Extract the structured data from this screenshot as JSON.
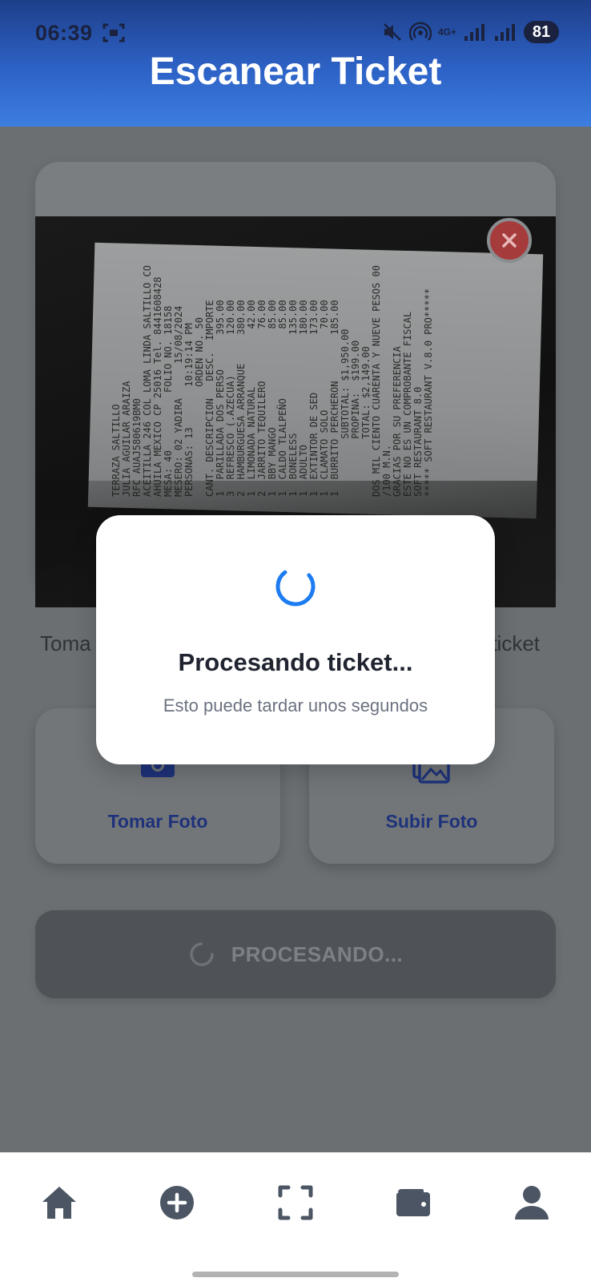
{
  "status_bar": {
    "time": "06:39",
    "network": "4G+",
    "battery": "81"
  },
  "header": {
    "title": "Escanear Ticket"
  },
  "photo": {
    "description_icon": "receipt-photo",
    "close_icon": "close-icon",
    "receipt_lines": [
      "TERRAZA SALTILLO",
      "JULIA AGUILAR ARAIZA",
      "RFC AUAJ580619BM0",
      "ACEITILLA 246 COL LOMA LINDA SALTILLO CO",
      "AHUILA MEXICO CP 25016 Tel. 8441608428",
      "MESA: 40          FOLIO NO. 18158",
      "MESERO: 02 YADIRA      15/08/2024",
      "PERSONAS: 13       10:19:14 PM",
      "                   ORDEN NO. 50",
      "CANT. DESCRIPCION   DESC.  IMPORTE",
      "1  PARILLADA DOS PERSO      395.00",
      "3  REFRESCO (.AZECUA)       120.00",
      "2  HAMBURGUESA ARRANQUE     380.00",
      "1  LIMONADA NATURAL          42.00",
      "2  JARRITO TEQUILERO         76.00",
      "1  BBY MANGO                 85.00",
      "1  CALDO TLALPEÑO            85.00",
      "1  BONELESS                 135.00",
      "1  ADULTO                   180.00",
      "1  EXTINTOR DE SED          173.00",
      "1  CLAMATO SOLO              70.00",
      "1  BURRITO PERCHERON        185.00",
      "          SUBTOTAL: $1,950.00",
      "          PROPINA:  $199.00",
      "          TOTAL: $2,149.00",
      "DOS MIL CIENTO CUARENTA Y NUEVE PESOS 00",
      "/100 M.N.",
      "GRACIAS POR SU PREFERENCIA",
      "ESTE NO ES UN COMPROBANTE FISCAL",
      "SOFT RESTAURANT 8.0",
      "***** SOFT RESTAURANT V.8.0 PRO*****"
    ]
  },
  "hint": {
    "left": "Toma",
    "right": "ticket"
  },
  "actions": [
    {
      "label": "Tomar Foto",
      "icon": "camera-icon"
    },
    {
      "label": "Subir Foto",
      "icon": "images-icon"
    }
  ],
  "process_button": {
    "label": "PROCESANDO..."
  },
  "modal": {
    "title": "Procesando ticket...",
    "subtitle": "Esto puede tardar unos segundos"
  },
  "bottom_nav": [
    {
      "name": "home",
      "icon": "home-icon"
    },
    {
      "name": "add",
      "icon": "plus-circle-icon"
    },
    {
      "name": "scan",
      "icon": "scan-icon"
    },
    {
      "name": "wallet",
      "icon": "wallet-icon"
    },
    {
      "name": "profile",
      "icon": "user-icon"
    }
  ],
  "colors": {
    "header_top": "#1e3f8a",
    "header_bottom": "#3d7ee0",
    "spinner": "#1d7cf2",
    "nav_icon": "#4b5563",
    "action_label": "#1e327a"
  }
}
